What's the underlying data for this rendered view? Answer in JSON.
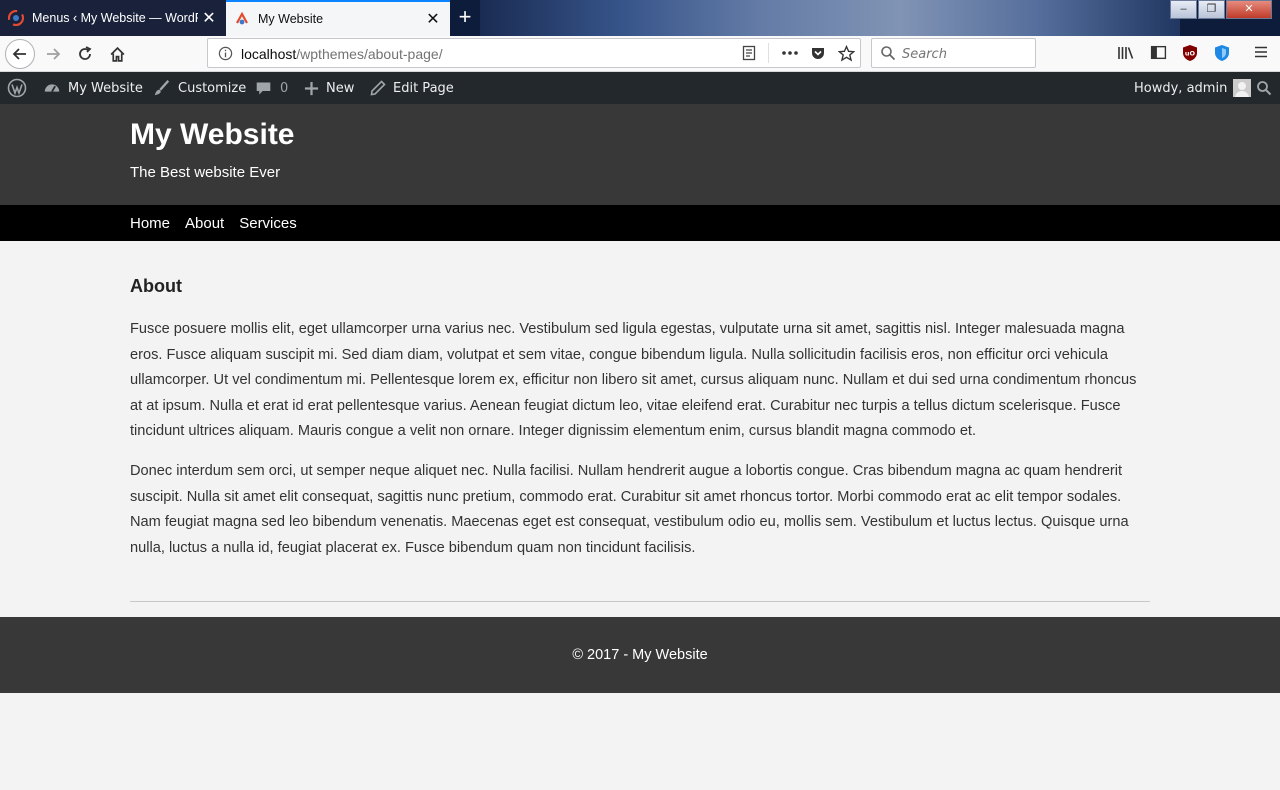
{
  "browser": {
    "tabs": [
      {
        "title": "Menus ‹ My Website — WordPress",
        "active": false
      },
      {
        "title": "My Website",
        "active": true
      }
    ],
    "url_host": "localhost",
    "url_path": "/wpthemes/about-page/",
    "search_placeholder": "Search",
    "accent_color": "#0a84ff",
    "window_controls": {
      "minimize": "–",
      "maximize": "❐",
      "close": "✕"
    }
  },
  "adminbar": {
    "site_name": "My Website",
    "customize": "Customize",
    "comments_count": "0",
    "new": "New",
    "edit_page": "Edit Page",
    "howdy": "Howdy, admin",
    "bg_color": "#23282d"
  },
  "site": {
    "title": "My Website",
    "description": "The Best website Ever",
    "menu": [
      "Home",
      "About",
      "Services"
    ],
    "header_color": "#383838",
    "nav_color": "#000000"
  },
  "page": {
    "title": "About",
    "paragraphs": [
      "Fusce posuere mollis elit, eget ullamcorper urna varius nec. Vestibulum sed ligula egestas, vulputate urna sit amet, sagittis nisl. Integer malesuada magna eros. Fusce aliquam suscipit mi. Sed diam diam, volutpat et sem vitae, congue bibendum ligula. Nulla sollicitudin facilisis eros, non efficitur orci vehicula ullamcorper. Ut vel condimentum mi. Pellentesque lorem ex, efficitur non libero sit amet, cursus aliquam nunc. Nullam et dui sed urna condimentum rhoncus at at ipsum. Nulla et erat id erat pellentesque varius. Aenean feugiat dictum leo, vitae eleifend erat. Curabitur nec turpis a tellus dictum scelerisque. Fusce tincidunt ultrices aliquam. Mauris congue a velit non ornare. Integer dignissim elementum enim, cursus blandit magna commodo et.",
      "Donec interdum sem orci, ut semper neque aliquet nec. Nulla facilisi. Nullam hendrerit augue a lobortis congue. Cras bibendum magna ac quam hendrerit suscipit. Nulla sit amet elit consequat, sagittis nunc pretium, commodo erat. Curabitur sit amet rhoncus tortor. Morbi commodo erat ac elit tempor sodales. Nam feugiat magna sed leo bibendum venenatis. Maecenas eget est consequat, vestibulum odio eu, mollis sem. Vestibulum et luctus lectus. Quisque urna nulla, luctus a nulla id, feugiat placerat ex. Fusce bibendum quam non tincidunt facilisis."
    ]
  },
  "footer": {
    "text": "© 2017 - My Website"
  }
}
